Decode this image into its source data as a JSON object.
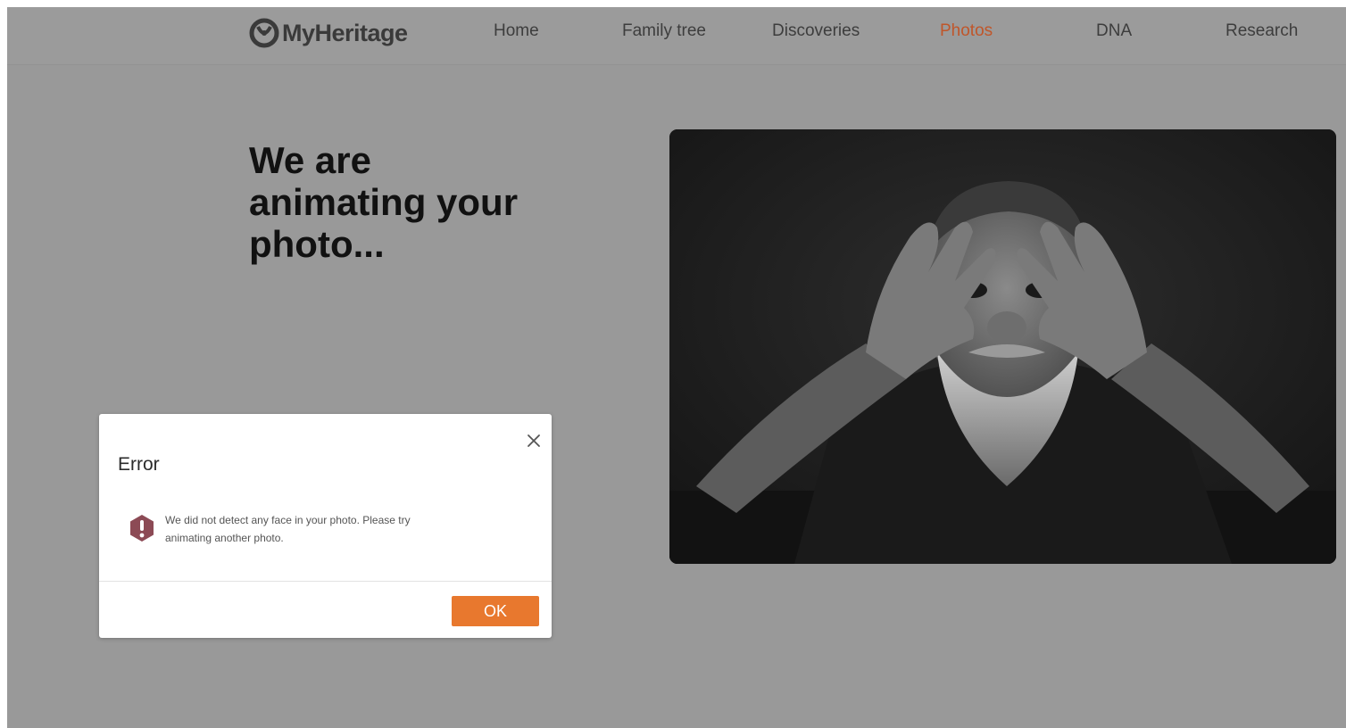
{
  "brand": {
    "name": "MyHeritage",
    "logo_icon": "myheritage-logo-icon"
  },
  "nav": {
    "items": [
      {
        "label": "Home",
        "active": false
      },
      {
        "label": "Family tree",
        "active": false
      },
      {
        "label": "Discoveries",
        "active": false
      },
      {
        "label": "Photos",
        "active": true
      },
      {
        "label": "DNA",
        "active": false
      },
      {
        "label": "Research",
        "active": false
      }
    ],
    "active_color": "#c0562a"
  },
  "main": {
    "headline_lines": [
      "We are",
      "animating your",
      "photo..."
    ]
  },
  "photo": {
    "icon": "portrait-photo",
    "style": "black-and-white"
  },
  "dialog": {
    "title": "Error",
    "message_lines": [
      "We did not detect any face in your photo. Please try",
      "animating another photo."
    ],
    "icon": "exclamation-icon",
    "icon_color": "#8c4a55",
    "close_icon": "close-icon",
    "ok_label": "OK",
    "ok_color": "#e8782e"
  },
  "colors": {
    "overlay": "#999999",
    "text_dark": "#111111"
  }
}
